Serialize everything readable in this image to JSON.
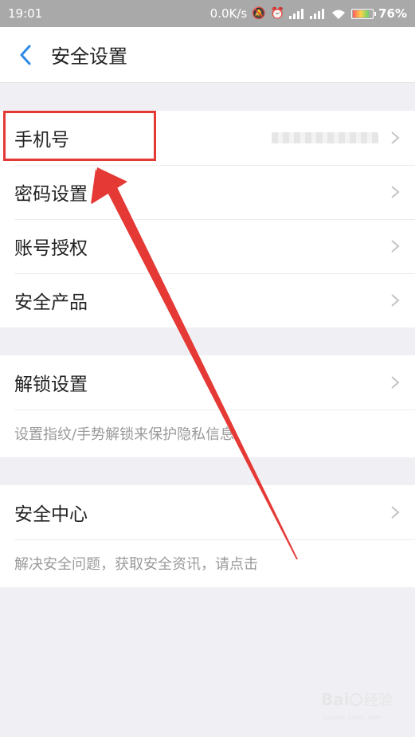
{
  "status_bar": {
    "time": "19:01",
    "network_speed": "0.0K/s",
    "battery_percent": "76%",
    "battery_level": 0.76
  },
  "nav": {
    "title": "安全设置"
  },
  "sections": [
    {
      "rows": [
        {
          "label": "手机号",
          "value_masked": true
        },
        {
          "label": "密码设置"
        },
        {
          "label": "账号授权"
        },
        {
          "label": "安全产品"
        }
      ]
    },
    {
      "rows": [
        {
          "label": "解锁设置"
        }
      ],
      "description": "设置指纹/手势解锁来保护隐私信息"
    },
    {
      "rows": [
        {
          "label": "安全中心"
        }
      ],
      "description": "解决安全问题，获取安全资讯，请点击"
    }
  ],
  "annotation": {
    "highlight_color": "#e53935",
    "arrow_color": "#e53935"
  },
  "watermark": {
    "brand": "Baidu",
    "text": "经验",
    "url": "jingyan.baidu.com"
  },
  "colors": {
    "accent_blue": "#2d8ae6",
    "background": "#f0eff4",
    "status_bar": "#a9a9a9"
  }
}
